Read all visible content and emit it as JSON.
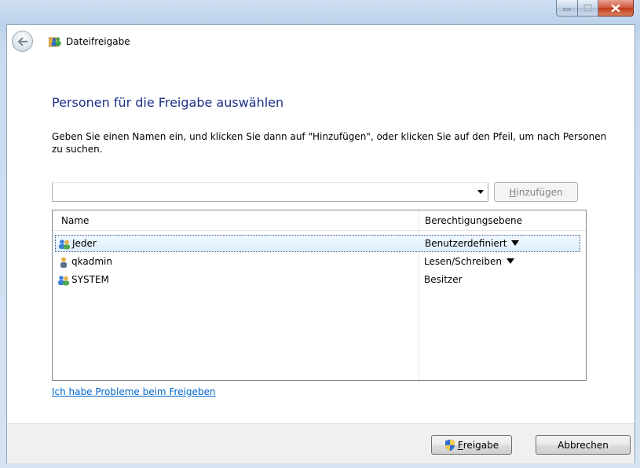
{
  "nav": {
    "title": "Dateifreigabe"
  },
  "heading": "Personen für die Freigabe auswählen",
  "instruction": "Geben Sie einen Namen ein, und klicken Sie dann auf \"Hinzufügen\", oder klicken Sie auf den Pfeil, um nach Personen zu suchen.",
  "name_input": {
    "value": ""
  },
  "add_button": {
    "accel": "H",
    "rest": "inzufügen"
  },
  "list": {
    "columns": {
      "name": "Name",
      "permission": "Berechtigungsebene"
    },
    "rows": [
      {
        "name": "Jeder",
        "permission": "Benutzerdefiniert",
        "has_dropdown": true,
        "icon": "group-users-icon",
        "selected": true
      },
      {
        "name": "qkadmin",
        "permission": "Lesen/Schreiben",
        "has_dropdown": true,
        "icon": "user-icon",
        "selected": false
      },
      {
        "name": "SYSTEM",
        "permission": "Besitzer",
        "has_dropdown": false,
        "icon": "group-users-icon",
        "selected": false
      }
    ]
  },
  "help_link": "Ich habe Probleme beim Freigeben",
  "footer": {
    "share_button": {
      "accel": "F",
      "rest": "reigabe"
    },
    "cancel_button": "Abbrechen"
  },
  "colors": {
    "heading": "#1e3287",
    "link": "#0066cc",
    "close": "#c03a1c"
  }
}
